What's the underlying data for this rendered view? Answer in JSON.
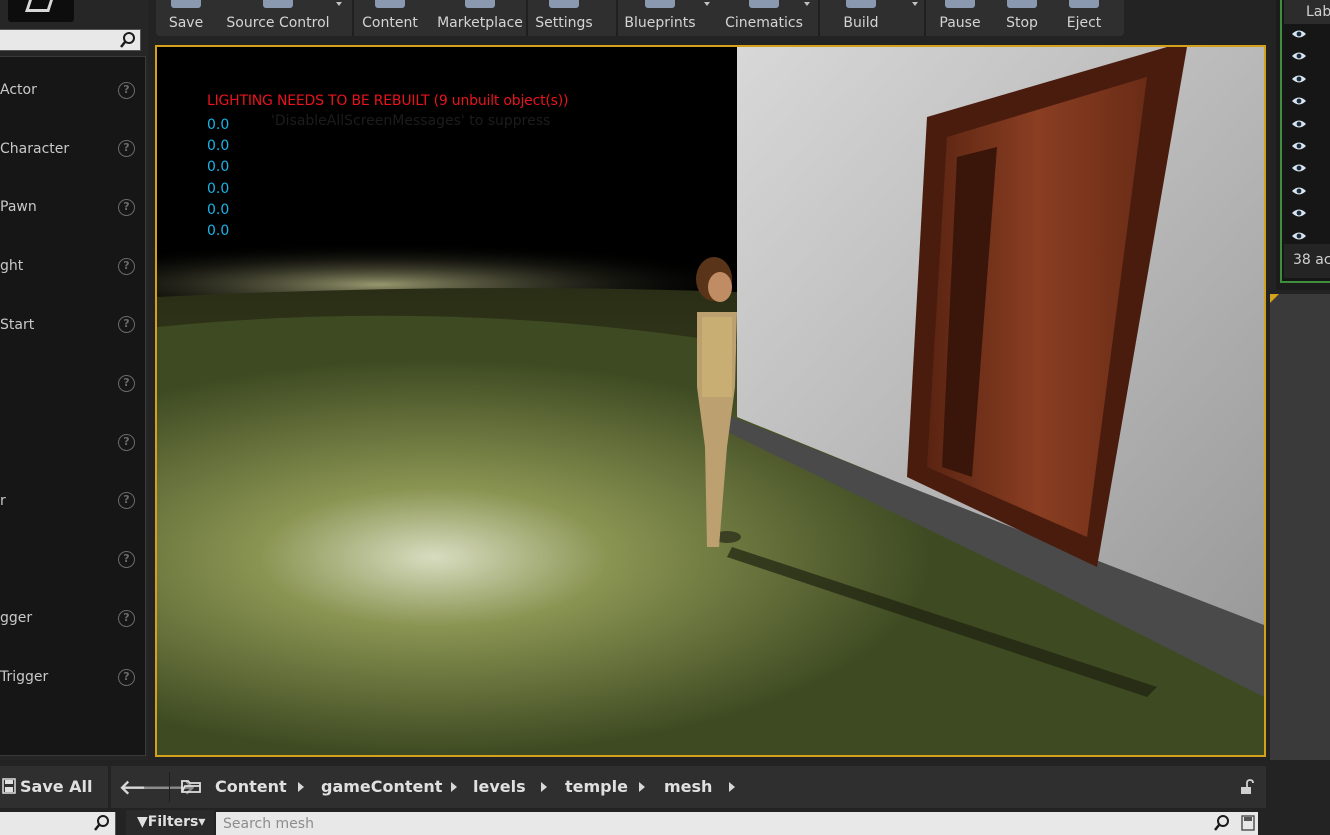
{
  "toolbar": {
    "buttons": [
      {
        "label": "Save",
        "icon": "save-icon"
      },
      {
        "label": "Source Control",
        "icon": "source-control-icon"
      },
      {
        "label": "Content",
        "icon": "content-icon"
      },
      {
        "label": "Marketplace",
        "icon": "marketplace-icon"
      },
      {
        "label": "Settings",
        "icon": "settings-icon"
      },
      {
        "label": "Blueprints",
        "icon": "blueprints-icon"
      },
      {
        "label": "Cinematics",
        "icon": "cinematics-icon"
      },
      {
        "label": "Build",
        "icon": "build-icon"
      },
      {
        "label": "Pause",
        "icon": "pause-icon"
      },
      {
        "label": "Stop",
        "icon": "stop-icon"
      },
      {
        "label": "Eject",
        "icon": "eject-icon"
      }
    ]
  },
  "place_panel": {
    "items": [
      {
        "label": "Actor"
      },
      {
        "label": "Character"
      },
      {
        "label": "Pawn"
      },
      {
        "label": "ght"
      },
      {
        "label": "Start"
      },
      {
        "label": ""
      },
      {
        "label": ""
      },
      {
        "label": "r"
      },
      {
        "label": ""
      },
      {
        "label": "gger"
      },
      {
        "label": " Trigger"
      }
    ],
    "help_glyph": "?"
  },
  "viewport": {
    "warning": "LIGHTING NEEDS TO BE REBUILT (9 unbuilt object(s))",
    "suppress_hint": "'DisableAllScreenMessages' to suppress",
    "stats": [
      "0.0",
      "0.0",
      "0.0",
      "0.0",
      "0.0",
      "0.0"
    ]
  },
  "outliner": {
    "header": "Lab",
    "count": "38 ac",
    "eye_rows": 10
  },
  "content_browser": {
    "save_all": "Save All",
    "back_glyph": "🡐",
    "forward_glyph": "🡒",
    "breadcrumbs": [
      "Content",
      "gameContent",
      "levels",
      "temple",
      "mesh"
    ],
    "filters_label": "Filters",
    "search_placeholder": "Search mesh"
  },
  "colors": {
    "viewport_border": "#d4a21a",
    "warning": "#e8141c",
    "stat": "#1ab3e8",
    "outliner_border": "#3e8e3e"
  }
}
